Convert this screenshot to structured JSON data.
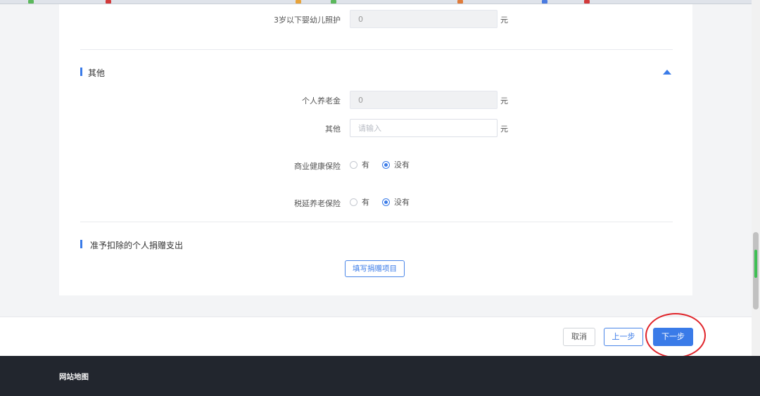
{
  "form": {
    "infant_care": {
      "label": "3岁以下婴幼儿照护",
      "value": "0",
      "unit": "元"
    },
    "section_other": {
      "title": "其他"
    },
    "personal_pension": {
      "label": "个人养老金",
      "value": "0",
      "unit": "元"
    },
    "other": {
      "label": "其他",
      "placeholder": "请输入",
      "unit": "元"
    },
    "commercial_health_insurance": {
      "label": "商业健康保险",
      "options": [
        {
          "label": "有",
          "checked": false
        },
        {
          "label": "没有",
          "checked": true
        }
      ]
    },
    "tax_deferred_pension_insurance": {
      "label": "税延养老保险",
      "options": [
        {
          "label": "有",
          "checked": false
        },
        {
          "label": "没有",
          "checked": true
        }
      ]
    },
    "section_donation": {
      "title": "准予扣除的个人捐赠支出",
      "button_label": "填写捐赠项目"
    }
  },
  "actions": {
    "cancel": "取消",
    "previous": "上一步",
    "next": "下一步"
  },
  "footer": {
    "title": "网站地图"
  },
  "colors": {
    "accent": "#3a7be8",
    "highlight": "#e0242a",
    "footer_bg": "#22262e"
  }
}
